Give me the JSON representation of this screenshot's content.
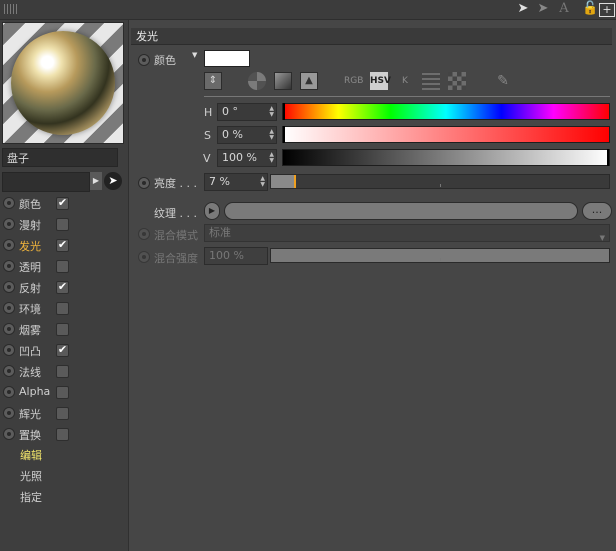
{
  "toolbar": {
    "grip_icon": "grip-icon",
    "back_icon": "back-arrow-icon",
    "forward_icon": "forward-arrow-icon",
    "text_icon": "text-icon",
    "lock_icon": "lock-icon",
    "new_icon": "new-panel-icon"
  },
  "material": {
    "name": "盘子"
  },
  "channels": [
    {
      "label": "颜色",
      "checked": "✔"
    },
    {
      "label": "漫射",
      "checked": ""
    },
    {
      "label": "发光",
      "checked": "✔"
    },
    {
      "label": "透明",
      "checked": ""
    },
    {
      "label": "反射",
      "checked": "✔"
    },
    {
      "label": "环境",
      "checked": ""
    },
    {
      "label": "烟雾",
      "checked": ""
    },
    {
      "label": "凹凸",
      "checked": "✔"
    },
    {
      "label": "法线",
      "checked": ""
    },
    {
      "label": "Alpha",
      "checked": ""
    },
    {
      "label": "辉光",
      "checked": ""
    },
    {
      "label": "置换",
      "checked": ""
    }
  ],
  "nav": {
    "edit": "编辑",
    "illumination": "光照",
    "assign": "指定"
  },
  "section": {
    "title": "发光"
  },
  "color": {
    "label": "颜色",
    "swatch": "#ffffff",
    "modes": [
      "RGB",
      "HSV",
      "K"
    ],
    "h_label": "H",
    "h_value": "0 °",
    "s_label": "S",
    "s_value": "0 %",
    "v_label": "V",
    "v_value": "100 %"
  },
  "brightness": {
    "label": "亮度 . . .",
    "value": "7 %",
    "fraction": 0.07
  },
  "texture": {
    "label": "纹理 . . .",
    "more": "..."
  },
  "blend_mode": {
    "label": "混合模式",
    "value": "标准"
  },
  "blend_strength": {
    "label": "混合强度",
    "value": "100 %",
    "fraction": 1.0
  }
}
